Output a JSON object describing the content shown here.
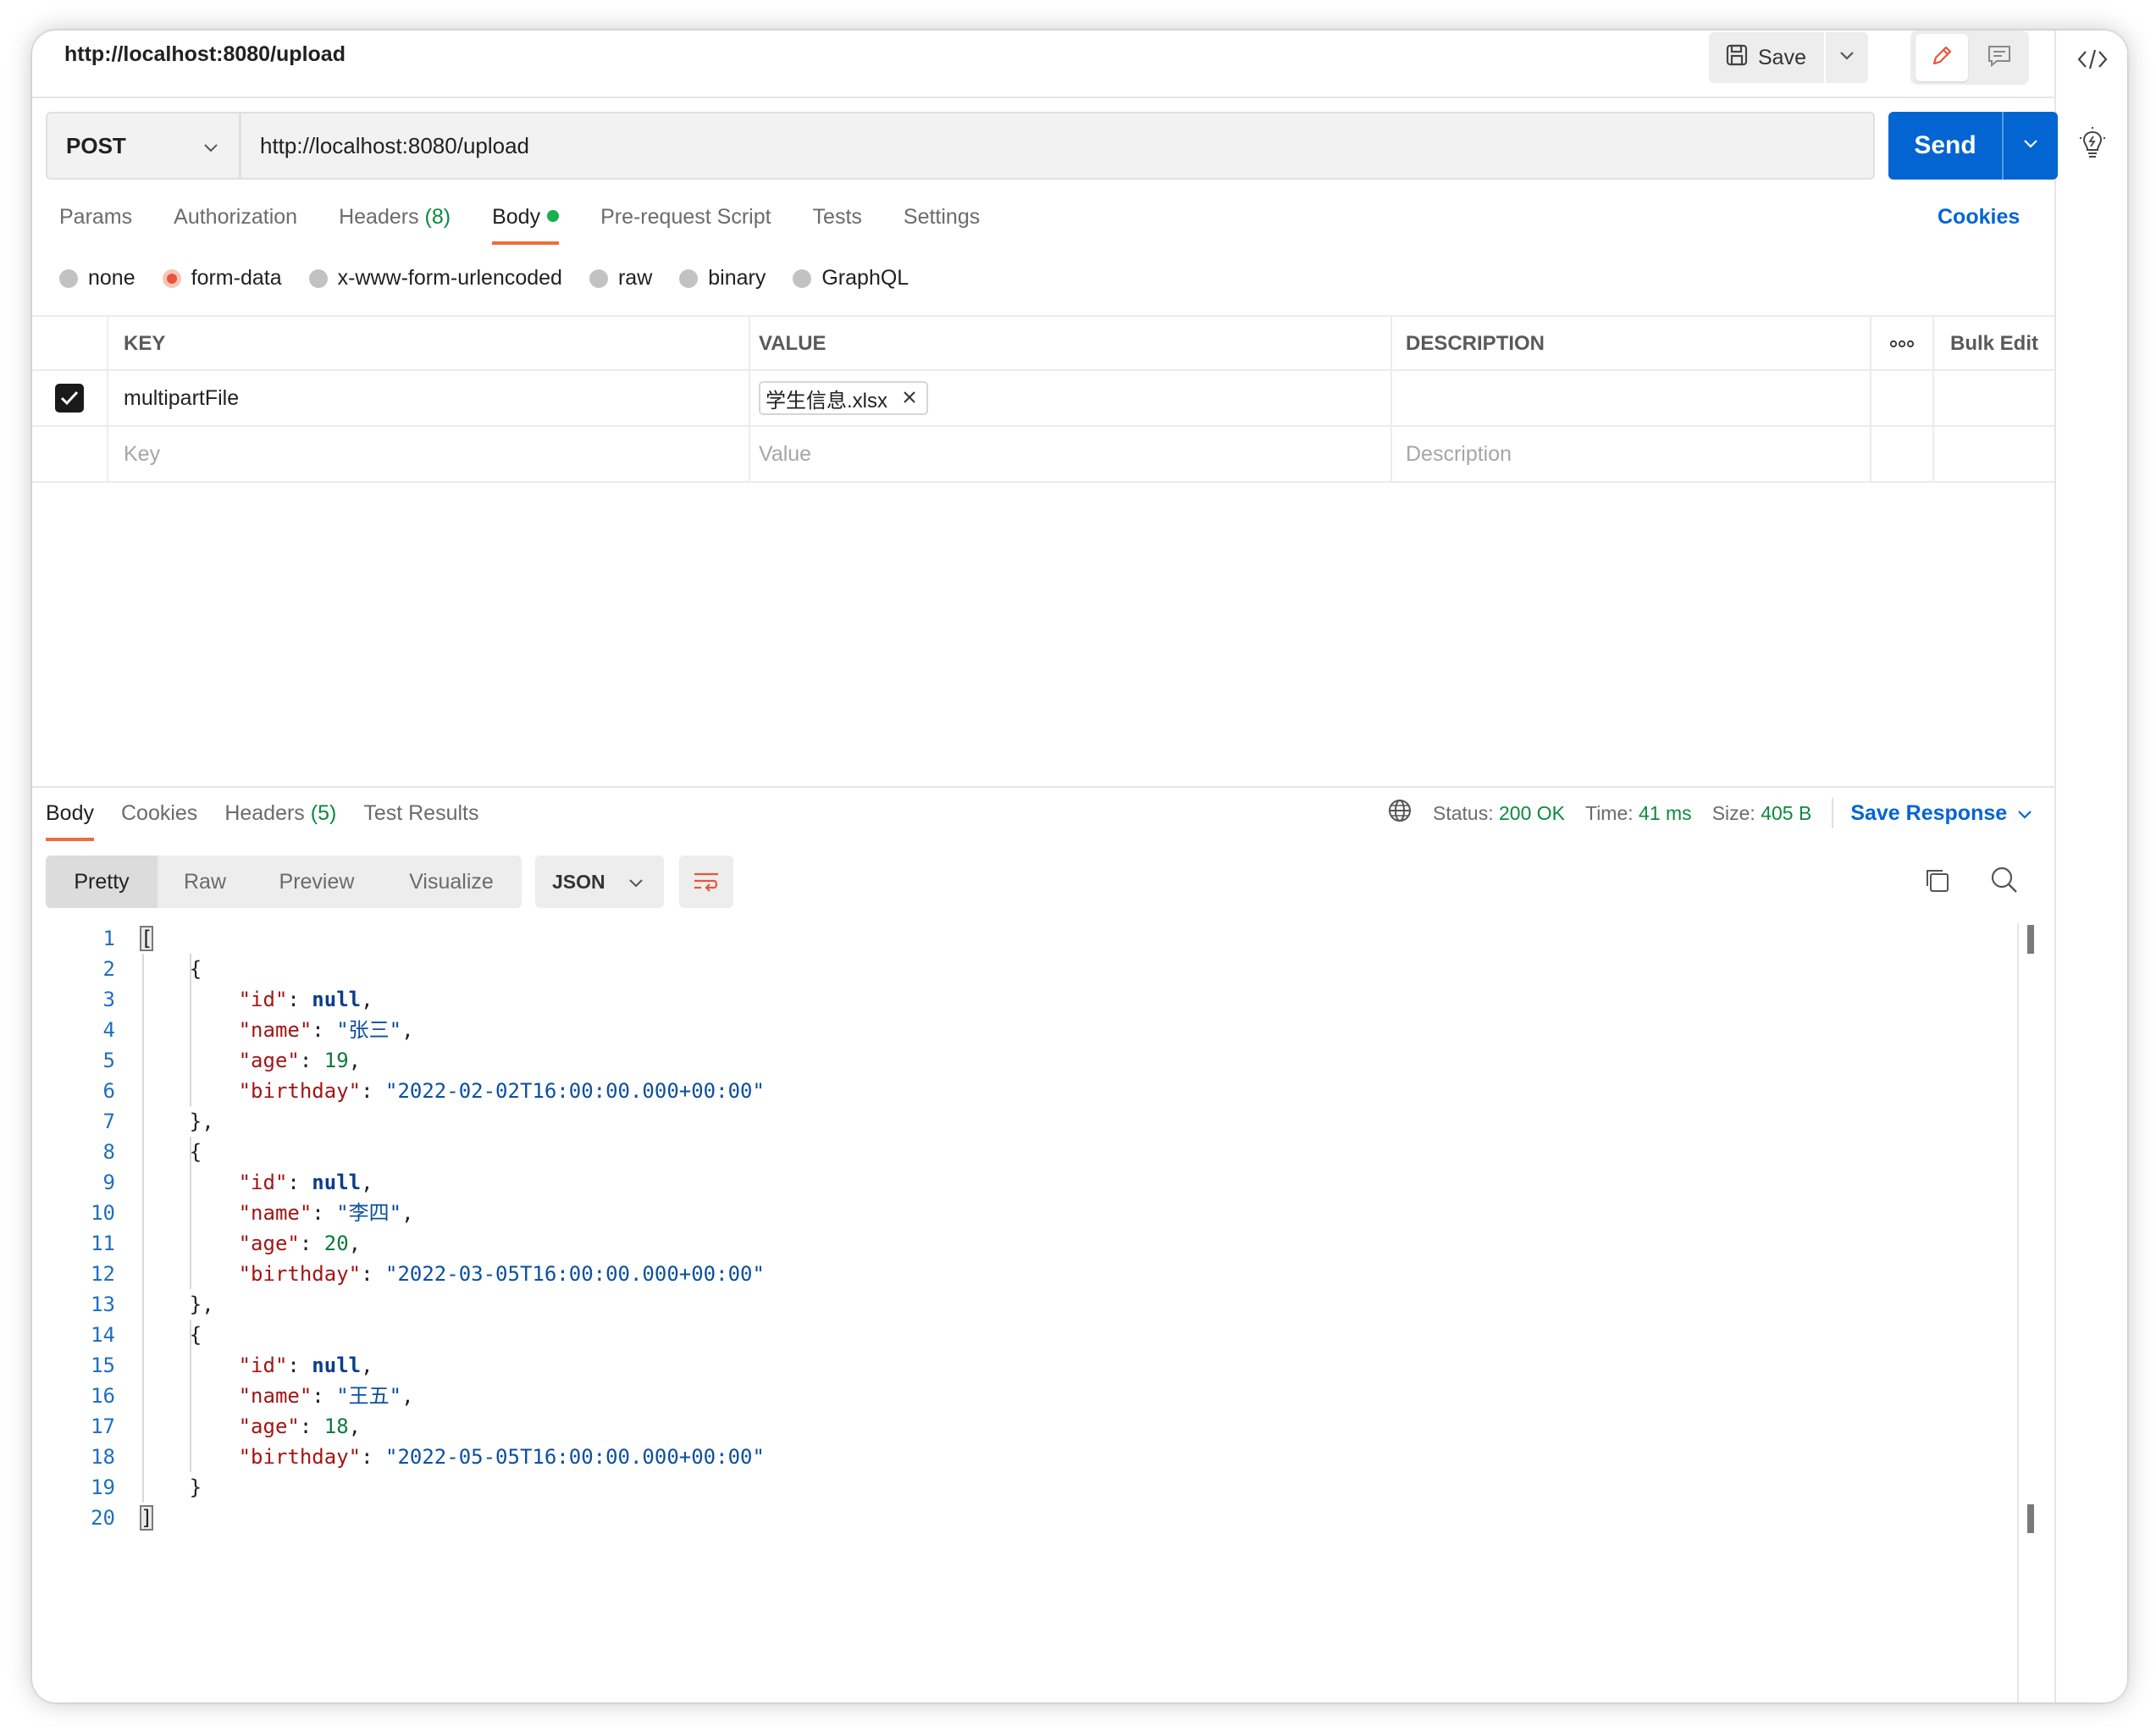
{
  "title_bar": {
    "url_title": "http://localhost:8080/upload",
    "save_label": "Save"
  },
  "request": {
    "method": "POST",
    "url": "http://localhost:8080/upload",
    "send_label": "Send"
  },
  "request_tabs": [
    {
      "label": "Params"
    },
    {
      "label": "Authorization"
    },
    {
      "label": "Headers",
      "count": "(8)"
    },
    {
      "label": "Body",
      "active": true
    },
    {
      "label": "Pre-request Script"
    },
    {
      "label": "Tests"
    },
    {
      "label": "Settings"
    }
  ],
  "cookies_label": "Cookies",
  "body_types": [
    {
      "label": "none"
    },
    {
      "label": "form-data",
      "selected": true
    },
    {
      "label": "x-www-form-urlencoded"
    },
    {
      "label": "raw"
    },
    {
      "label": "binary"
    },
    {
      "label": "GraphQL"
    }
  ],
  "form_table": {
    "headers": {
      "key": "KEY",
      "value": "VALUE",
      "description": "DESCRIPTION",
      "bulk_edit": "Bulk Edit"
    },
    "rows": [
      {
        "checked": true,
        "key": "multipartFile",
        "file_value": "学生信息.xlsx",
        "description": ""
      }
    ],
    "placeholders": {
      "key": "Key",
      "value": "Value",
      "description": "Description"
    }
  },
  "response": {
    "tabs": [
      {
        "label": "Body",
        "active": true
      },
      {
        "label": "Cookies"
      },
      {
        "label": "Headers",
        "count": "(5)"
      },
      {
        "label": "Test Results"
      }
    ],
    "status_label": "Status:",
    "status_value": "200 OK",
    "time_label": "Time:",
    "time_value": "41 ms",
    "size_label": "Size:",
    "size_value": "405 B",
    "save_response_label": "Save Response",
    "format_buttons": [
      "Pretty",
      "Raw",
      "Preview",
      "Visualize"
    ],
    "format_active": "Pretty",
    "language": "JSON",
    "line_numbers": [
      "1",
      "2",
      "3",
      "4",
      "5",
      "6",
      "7",
      "8",
      "9",
      "10",
      "11",
      "12",
      "13",
      "14",
      "15",
      "16",
      "17",
      "18",
      "19",
      "20"
    ],
    "records": [
      {
        "id": "null",
        "name": "\"张三\"",
        "age": "19",
        "birthday": "\"2022-02-02T16:00:00.000+00:00\""
      },
      {
        "id": "null",
        "name": "\"李四\"",
        "age": "20",
        "birthday": "\"2022-03-05T16:00:00.000+00:00\""
      },
      {
        "id": "null",
        "name": "\"王五\"",
        "age": "18",
        "birthday": "\"2022-05-05T16:00:00.000+00:00\""
      }
    ],
    "json_keys": {
      "id": "\"id\"",
      "name": "\"name\"",
      "age": "\"age\"",
      "birthday": "\"birthday\""
    }
  },
  "colors": {
    "accent_orange": "#f26b3a",
    "send_blue": "#0265d2",
    "status_green": "#0b8a3d"
  },
  "icons": [
    "save-icon",
    "chevron-down-icon",
    "pencil-icon",
    "comment-icon",
    "code-icon",
    "lightbulb-icon",
    "globe-icon",
    "copy-icon",
    "search-icon",
    "wrap-lines-icon",
    "close-icon",
    "checkmark-icon",
    "more-icon"
  ]
}
